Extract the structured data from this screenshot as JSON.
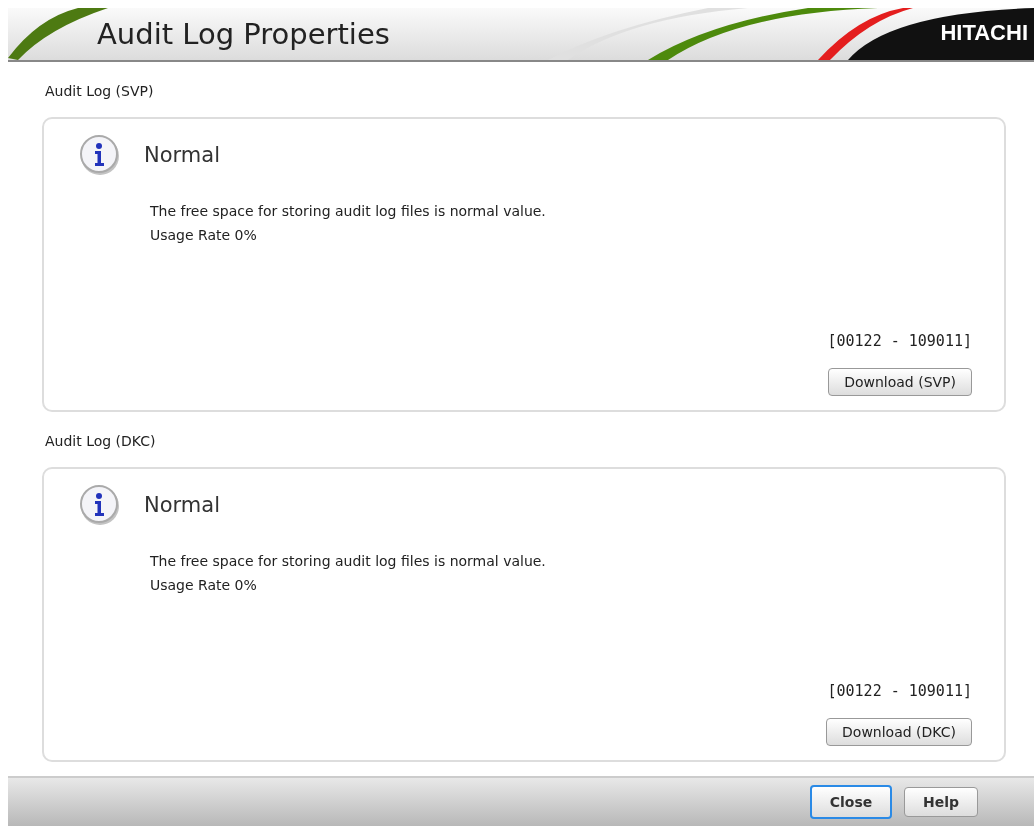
{
  "window": {
    "title": "Audit Log Properties",
    "brand": "HITACHI"
  },
  "sections": [
    {
      "label": "Audit Log (SVP)",
      "status": "Normal",
      "message": "The free space for storing audit log files is normal value.",
      "usage": "Usage Rate 0%",
      "code": "[00122 - 109011]",
      "button": "Download (SVP)"
    },
    {
      "label": "Audit Log (DKC)",
      "status": "Normal",
      "message": "The free space for storing audit log files is normal value.",
      "usage": "Usage Rate 0%",
      "code": "[00122 - 109011]",
      "button": "Download (DKC)"
    }
  ],
  "buttons": [
    {
      "label": "Close",
      "focused": true
    },
    {
      "label": "Help",
      "focused": false
    }
  ]
}
